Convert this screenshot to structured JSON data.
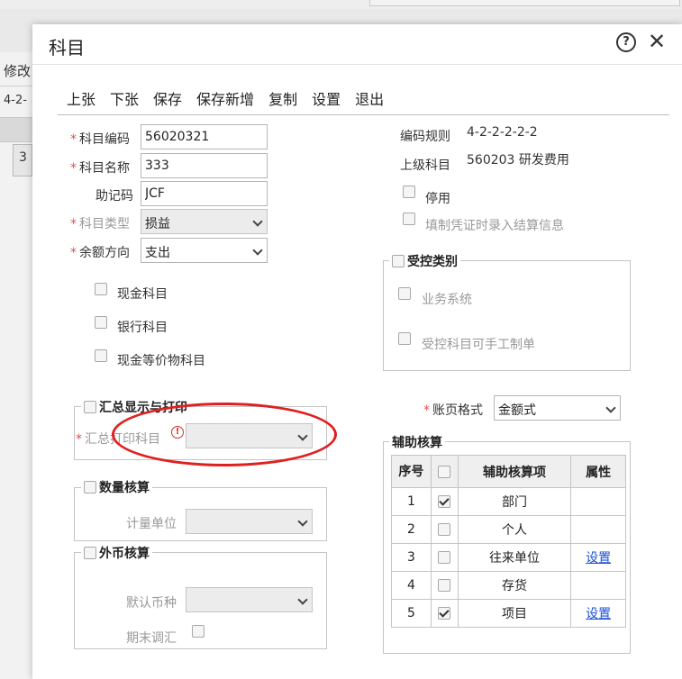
{
  "background": {
    "modify_label": "修改",
    "rule_label": "4-2-",
    "cell_value": "3"
  },
  "dialog": {
    "title": "科目"
  },
  "toolbar": {
    "prev": "上张",
    "next": "下张",
    "save": "保存",
    "save_new": "保存新增",
    "copy": "复制",
    "settings": "设置",
    "exit": "退出"
  },
  "form": {
    "code_label": "科目编码",
    "code_value": "56020321",
    "name_label": "科目名称",
    "name_value": "333",
    "mnemonic_label": "助记码",
    "mnemonic_value": "JCF",
    "type_label": "科目类型",
    "type_value": "损益",
    "direction_label": "余额方向",
    "direction_value": "支出",
    "cash_label": "现金科目",
    "bank_label": "银行科目",
    "cash_equiv_label": "现金等价物科目"
  },
  "right": {
    "rule_label": "编码规则",
    "rule_value": "4-2-2-2-2-2",
    "parent_label": "上级科目",
    "parent_value": "560203 研发费用",
    "disable_label": "停用",
    "settlement_label": "填制凭证时录入结算信息"
  },
  "controlled": {
    "legend": "受控类别",
    "business_system": "业务系统",
    "manual_voucher": "受控科目可手工制单"
  },
  "summary": {
    "legend": "汇总显示与打印",
    "print_subject_label": "汇总打印科目"
  },
  "quantity": {
    "legend": "数量核算",
    "unit_label": "计量单位"
  },
  "foreign": {
    "legend": "外币核算",
    "currency_label": "默认币种",
    "period_end_label": "期末调汇"
  },
  "ledger": {
    "label": "账页格式",
    "value": "金额式"
  },
  "aux": {
    "legend": "辅助核算",
    "headers": [
      "序号",
      "辅助核算项",
      "属性"
    ],
    "rows": [
      {
        "no": "1",
        "name": "部门",
        "checked": true,
        "attr": ""
      },
      {
        "no": "2",
        "name": "个人",
        "checked": false,
        "attr": ""
      },
      {
        "no": "3",
        "name": "往来单位",
        "checked": false,
        "attr": "设置"
      },
      {
        "no": "4",
        "name": "存货",
        "checked": false,
        "attr": ""
      },
      {
        "no": "5",
        "name": "项目",
        "checked": true,
        "attr": "设置"
      }
    ]
  },
  "colors": {
    "required_star": "#e05050",
    "link": "#1a4fd6",
    "highlight_ellipse": "#e02020"
  }
}
